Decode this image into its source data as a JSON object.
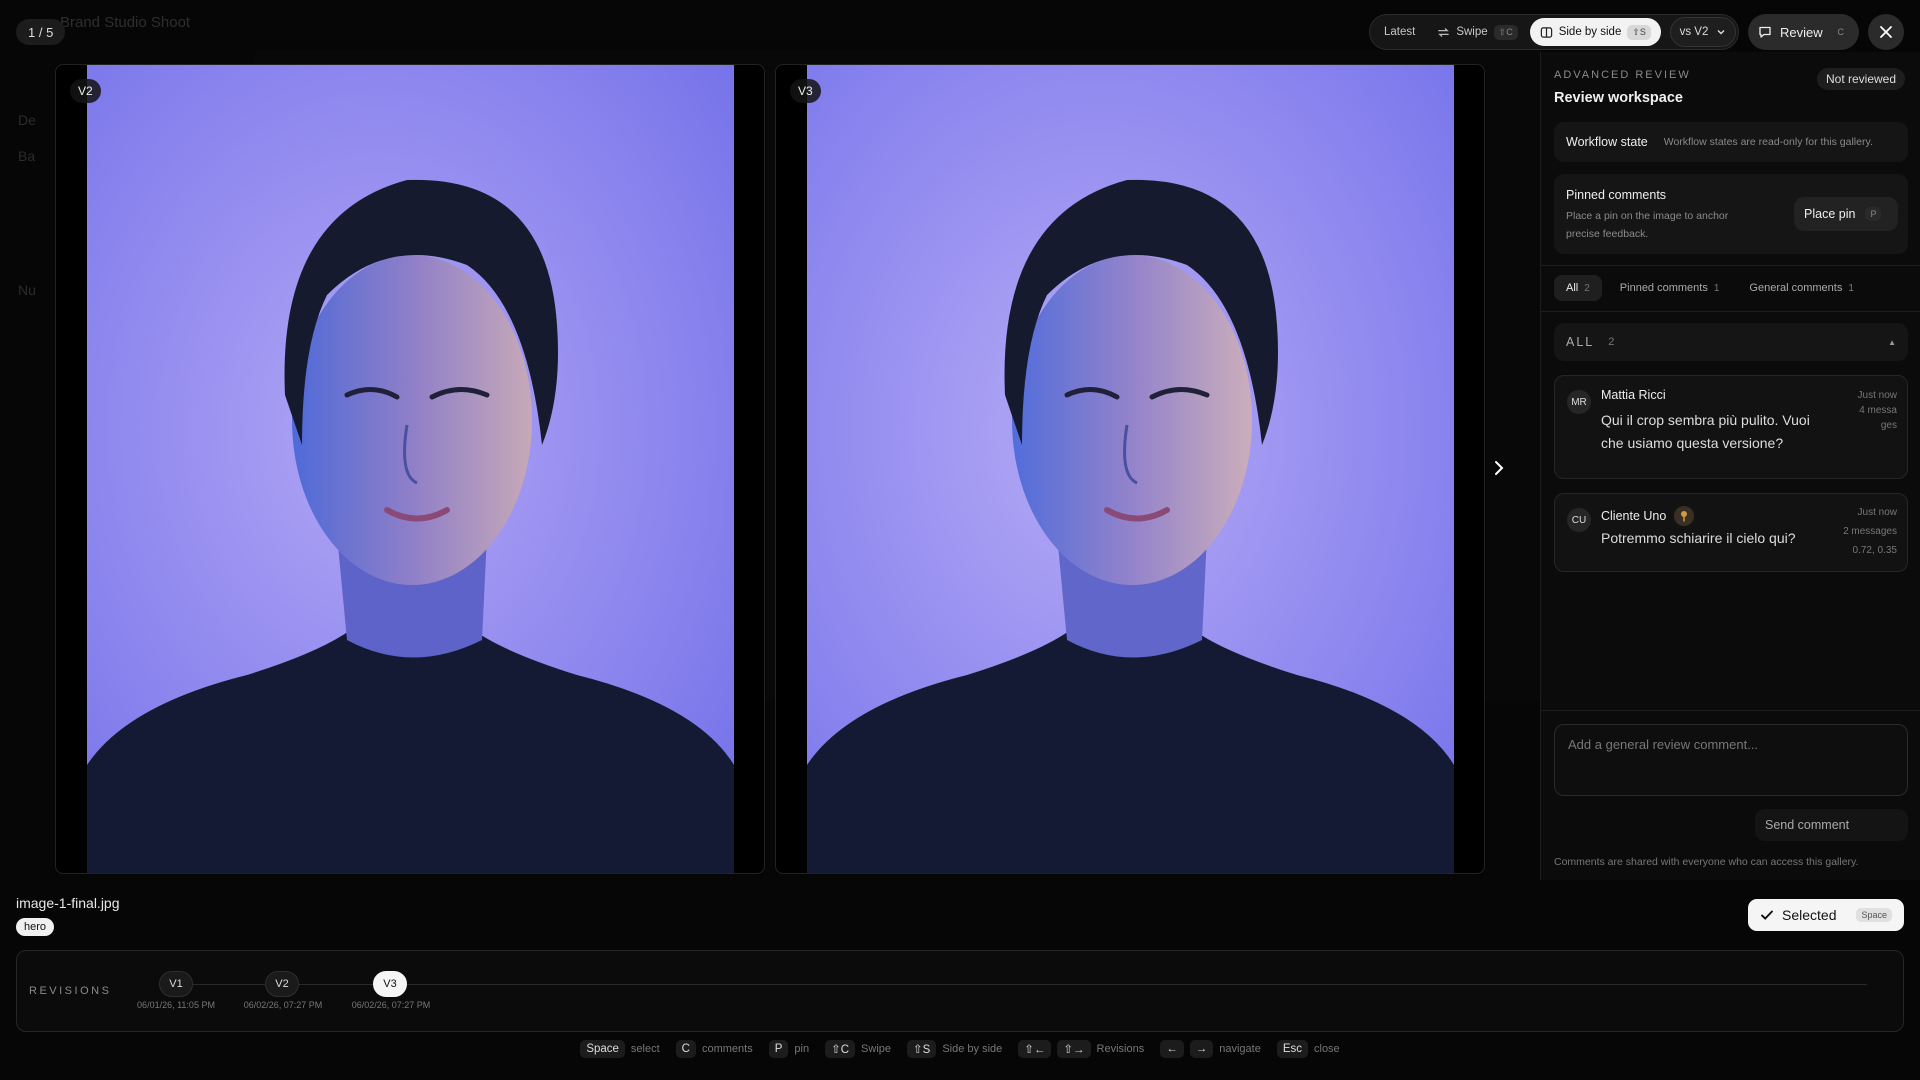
{
  "viewer": {
    "counter": "1 / 5"
  },
  "background": {
    "title": "Brand Studio Shoot",
    "items": [
      "De",
      "Ba",
      "Nu"
    ]
  },
  "toolbar": {
    "latest": "Latest",
    "swipe": "Swipe",
    "swipe_shortcut": "⇧C",
    "side_by_side": "Side by side",
    "side_by_side_shortcut": "⇧S",
    "compare_select": "vs V2",
    "review": "Review",
    "review_shortcut": "C"
  },
  "images": {
    "left_label": "V2",
    "right_label": "V3"
  },
  "panel": {
    "eyebrow": "ADVANCED REVIEW",
    "title": "Review workspace",
    "status": "Not reviewed",
    "workflow_label": "Workflow state",
    "workflow_hint": "Workflow states are read-only for this gallery.",
    "pinned_title": "Pinned comments",
    "pinned_desc": "Place a pin on the image to anchor precise feedback.",
    "place_pin": "Place pin",
    "place_pin_shortcut": "P",
    "tabs": [
      {
        "label": "All",
        "count": "2"
      },
      {
        "label": "Pinned comments",
        "count": "1"
      },
      {
        "label": "General comments",
        "count": "1"
      }
    ],
    "group_label": "ALL",
    "group_count": "2",
    "comments": [
      {
        "initials": "MR",
        "author": "Mattia Ricci",
        "text": "Qui il crop sembra più pulito. Vuoi che usiamo questa versione?",
        "meta": "Just now 4 messages"
      },
      {
        "initials": "CU",
        "author": "Cliente Uno",
        "text": "Potremmo schiarire il cielo qui?",
        "time": "Just now",
        "messages": "2 messages",
        "coords": "0.72, 0.35"
      }
    ],
    "composer_placeholder": "Add a general review comment...",
    "send": "Send comment",
    "footnote": "Comments are shared with everyone who can access this gallery."
  },
  "asset": {
    "filename": "image-1-final.jpg",
    "tag": "hero",
    "selected": "Selected",
    "selected_shortcut": "Space"
  },
  "revisions": {
    "title": "REVISIONS",
    "items": [
      {
        "label": "V1",
        "date": "06/01/26, 11:05 PM"
      },
      {
        "label": "V2",
        "date": "06/02/26, 07:27 PM"
      },
      {
        "label": "V3",
        "date": "06/02/26, 07:27 PM"
      }
    ]
  },
  "shortcuts": [
    {
      "keys": [
        "Space"
      ],
      "label": "select"
    },
    {
      "keys": [
        "C"
      ],
      "label": "comments"
    },
    {
      "keys": [
        "P"
      ],
      "label": "pin"
    },
    {
      "keys": [
        "⇧C"
      ],
      "label": "Swipe"
    },
    {
      "keys": [
        "⇧S"
      ],
      "label": "Side by side"
    },
    {
      "keys": [
        "⇧←",
        "⇧→"
      ],
      "label": "Revisions"
    },
    {
      "keys": [
        "←",
        "→"
      ],
      "label": "navigate"
    },
    {
      "keys": [
        "Esc"
      ],
      "label": "close"
    }
  ]
}
